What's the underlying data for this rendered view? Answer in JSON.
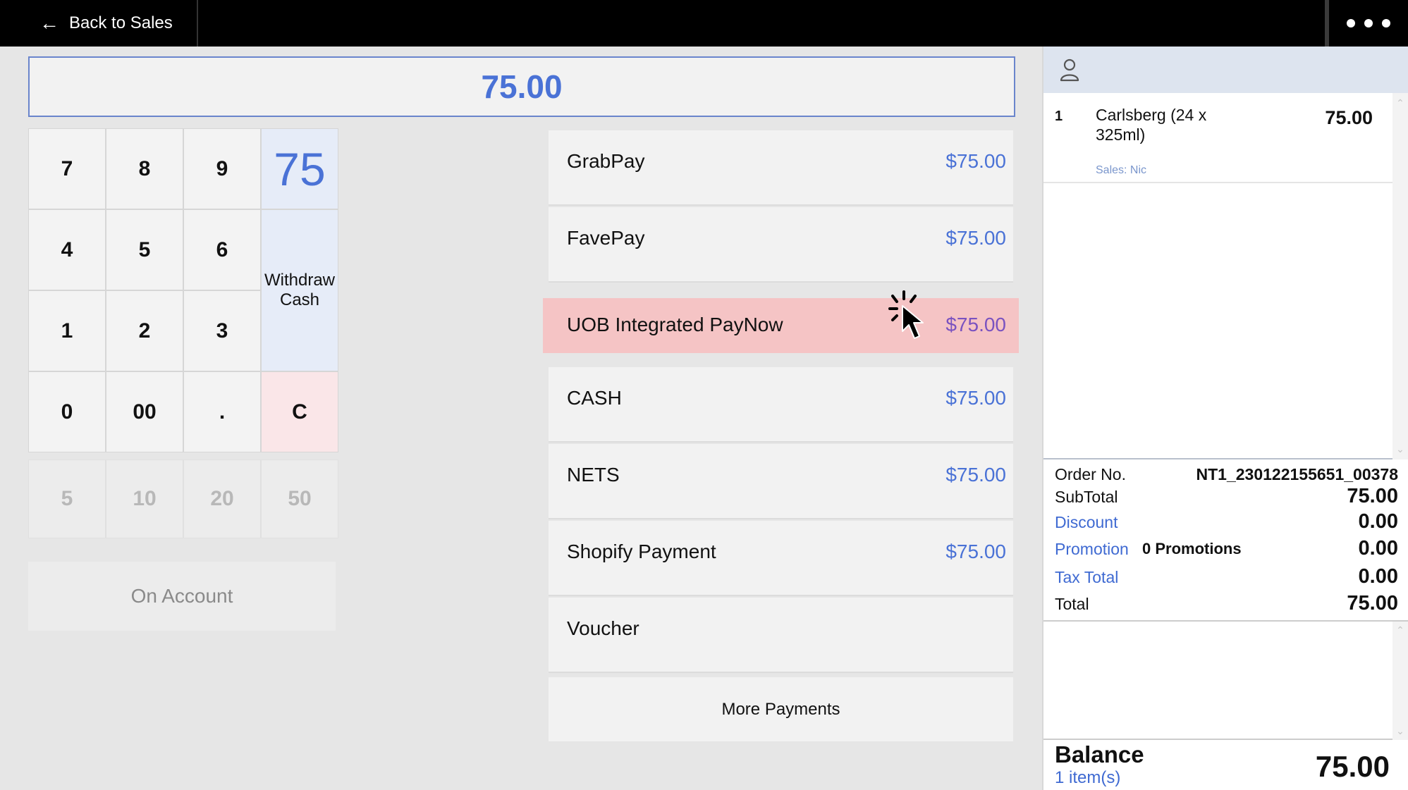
{
  "topbar": {
    "back_label": "Back to Sales",
    "back_icon": "arrow-left-icon",
    "more_icon": "more-dots-icon"
  },
  "amount_display": "75.00",
  "keypad": {
    "keys": [
      "7",
      "8",
      "9",
      "4",
      "5",
      "6",
      "1",
      "2",
      "3",
      "0",
      "00",
      ".",
      "C"
    ],
    "entry_display": "75",
    "withdraw_label_1": "Withdraw",
    "withdraw_label_2": "Cash"
  },
  "quick_amounts": [
    "5",
    "10",
    "20",
    "50"
  ],
  "on_account_label": "On Account",
  "payments": [
    {
      "name": "GrabPay",
      "amount": "$75.00"
    },
    {
      "name": "FavePay",
      "amount": "$75.00"
    },
    {
      "name": "UOB Integrated PayNow",
      "amount": "$75.00"
    },
    {
      "name": "CASH",
      "amount": "$75.00"
    },
    {
      "name": "NETS",
      "amount": "$75.00"
    },
    {
      "name": "Shopify Payment",
      "amount": "$75.00"
    },
    {
      "name": "Voucher",
      "amount": ""
    }
  ],
  "more_payments_label": "More Payments",
  "cart": {
    "customer_icon": "user-icon",
    "items": [
      {
        "qty": "1",
        "name": "Carlsberg (24 x 325ml)",
        "price": "75.00",
        "sales": "Sales: Nic"
      }
    ]
  },
  "totals": {
    "order_no_label": "Order No.",
    "order_no": "NT1_230122155651_00378",
    "subtotal_label": "SubTotal",
    "subtotal": "75.00",
    "discount_label": "Discount",
    "discount": "0.00",
    "promotion_label": "Promotion",
    "promotion_note": "0 Promotions",
    "promotion": "0.00",
    "tax_label": "Tax Total",
    "tax": "0.00",
    "total_label": "Total",
    "total": "75.00"
  },
  "balance": {
    "label": "Balance",
    "items": "1 item(s)",
    "value": "75.00"
  },
  "colors": {
    "accent": "#4a72d6",
    "highlight": "#f5c4c5",
    "panel_header": "#dde4ef"
  }
}
